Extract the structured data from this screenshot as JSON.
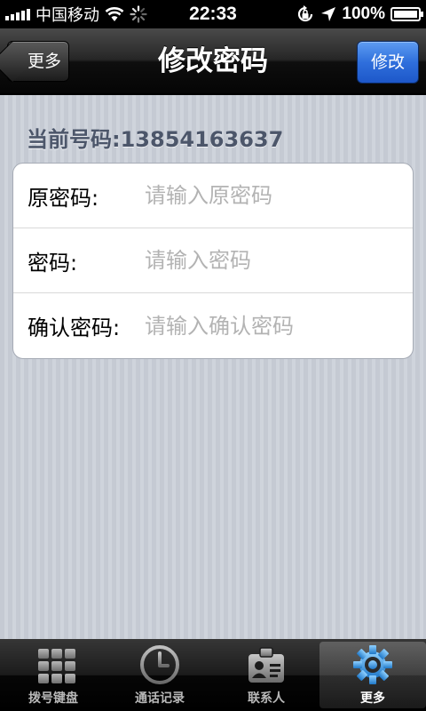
{
  "status_bar": {
    "carrier": "中国移动",
    "time": "22:33",
    "battery": "100%"
  },
  "nav": {
    "title": "修改密码",
    "back_label": "更多",
    "action_label": "修改"
  },
  "content": {
    "current_number": "当前号码:13854163637",
    "fields": [
      {
        "label": "原密码:",
        "placeholder": "请输入原密码"
      },
      {
        "label": "密码:",
        "placeholder": "请输入密码"
      },
      {
        "label": "确认密码:",
        "placeholder": "请输入确认密码"
      }
    ]
  },
  "tabs": [
    {
      "label": "拨号键盘",
      "icon": "keypad-icon",
      "active": false
    },
    {
      "label": "通话记录",
      "icon": "clock-icon",
      "active": false
    },
    {
      "label": "联系人",
      "icon": "contacts-icon",
      "active": false
    },
    {
      "label": "更多",
      "icon": "gear-icon",
      "active": true
    }
  ],
  "colors": {
    "nav_bar": "#1a1a1a",
    "action_button": "#2f6fdc",
    "background": "#c7ccd6",
    "active_tab_icon": "#4aa6e8"
  }
}
